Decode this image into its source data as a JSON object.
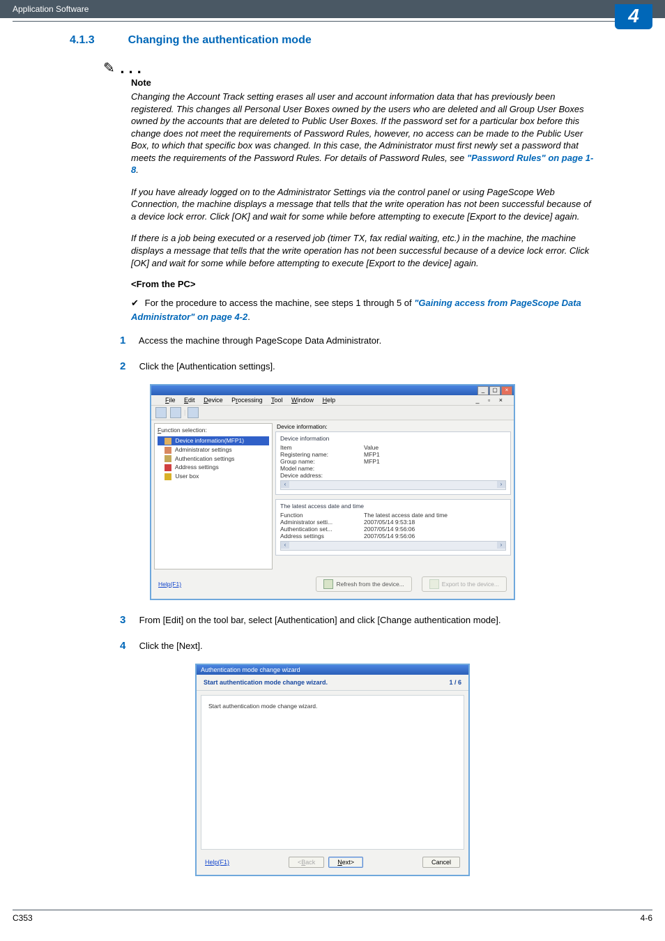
{
  "header": {
    "section_name": "Application Software",
    "chapter_number": "4"
  },
  "footer": {
    "model": "C353",
    "page_num": "4-6"
  },
  "section": {
    "number": "4.1.3",
    "title": "Changing the authentication mode"
  },
  "note": {
    "label": "Note",
    "p1a": "Changing the Account Track setting erases all user and account information data that has previously been registered. This changes all Personal User Boxes owned by the users who are deleted and all Group User Boxes owned by the accounts that are deleted to Public User Boxes. If the password set for a particular box before this change does not meet the requirements of Password Rules, however, no access can be made to the Public User Box, to which that specific box was changed. In this case, the Administrator must first newly set a password that meets the requirements of the Password Rules. For details of Password Rules, see ",
    "p1link": "\"Password Rules\" on page 1-8",
    "p1b": ".",
    "p2": "If you have already logged on to the Administrator Settings via the control panel or using PageScope Web Connection, the machine displays a message that tells that the write operation has not been successful because of a device lock error. Click [OK] and wait for some while before attempting to execute [Export to the device] again.",
    "p3": "If there is a job being executed or a reserved job (timer TX, fax redial waiting, etc.) in the machine, the machine displays a message that tells that the write operation has not been successful because of a device lock error. Click [OK] and wait for some while before attempting to execute [Export to the device] again."
  },
  "from_pc": {
    "heading": "<From the PC>"
  },
  "check": {
    "text_a": "For the procedure to access the machine, see steps 1 through 5 of ",
    "link": "\"Gaining access from PageScope Data Administrator\" on page 4-2",
    "text_b": "."
  },
  "steps": {
    "s1": "Access the machine through PageScope Data Administrator.",
    "s2": "Click the [Authentication settings].",
    "s3": "From [Edit] on the tool bar, select [Authentication] and click [Change authentication mode].",
    "s4": "Click the [Next]."
  },
  "ss1": {
    "menu": {
      "file": "File",
      "edit": "Edit",
      "device": "Device",
      "processing": "Processing",
      "tool": "Tool",
      "window": "Window",
      "help": "Help"
    },
    "left": {
      "label": "Function selection:",
      "item1": "Device information(MFP1)",
      "item2": "Administrator settings",
      "item3": "Authentication settings",
      "item4": "Address settings",
      "item5": "User box"
    },
    "right": {
      "info_label": "Device information:",
      "group1": {
        "title": "Device information",
        "col1": "Item",
        "col2": "Value",
        "r1a": "Registering name:",
        "r1b": "MFP1",
        "r2a": "Group name:",
        "r2b": "MFP1",
        "r3a": "Model name:",
        "r4a": "Device address:"
      },
      "group2": {
        "title": "The latest access date and time",
        "col1": "Function",
        "col2": "The latest access date and time",
        "r1a": "Administrator setti...",
        "r1b": "2007/05/14 9:53:18",
        "r2a": "Authentication set...",
        "r2b": "2007/05/14 9:56:06",
        "r3a": "Address settings",
        "r3b": "2007/05/14 9:56:06"
      }
    },
    "footer": {
      "help": "Help(F1)",
      "refresh": "Refresh from the device...",
      "export": "Export to the device..."
    }
  },
  "ss2": {
    "titlebar": "Authentication mode change wizard",
    "sub_left": "Start authentication mode change wizard.",
    "sub_right": "1 / 6",
    "body": "Start authentication mode change wizard.",
    "help": "Help(F1)",
    "back": "<Back",
    "next": "Next>",
    "cancel": "Cancel"
  }
}
